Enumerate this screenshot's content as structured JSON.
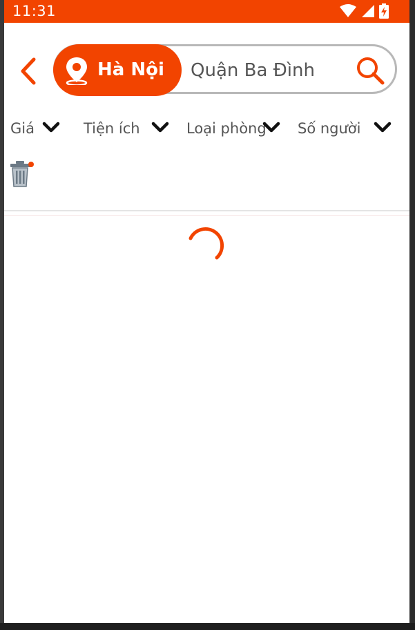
{
  "status_bar": {
    "time": "11:31",
    "icons": [
      "wifi-icon",
      "signal-icon",
      "battery-charging-icon"
    ]
  },
  "header": {
    "back_icon": "chevron-left-icon",
    "city": "Hà Nội",
    "city_icon": "location-pin-icon",
    "district_value": "Quận Ba Đình",
    "search_icon": "search-icon"
  },
  "filters": [
    {
      "label": "Giá",
      "icon": "chevron-down-icon"
    },
    {
      "label": "Tiện ích",
      "icon": "chevron-down-icon"
    },
    {
      "label": "Loại phòng",
      "icon": "chevron-down-icon"
    },
    {
      "label": "Số người",
      "icon": "chevron-down-icon"
    }
  ],
  "clear_filters_icon": "trash-icon",
  "loading": true,
  "colors": {
    "accent": "#f24400",
    "border": "#b8b8b8",
    "text": "#555555",
    "chevron": "#111111"
  }
}
